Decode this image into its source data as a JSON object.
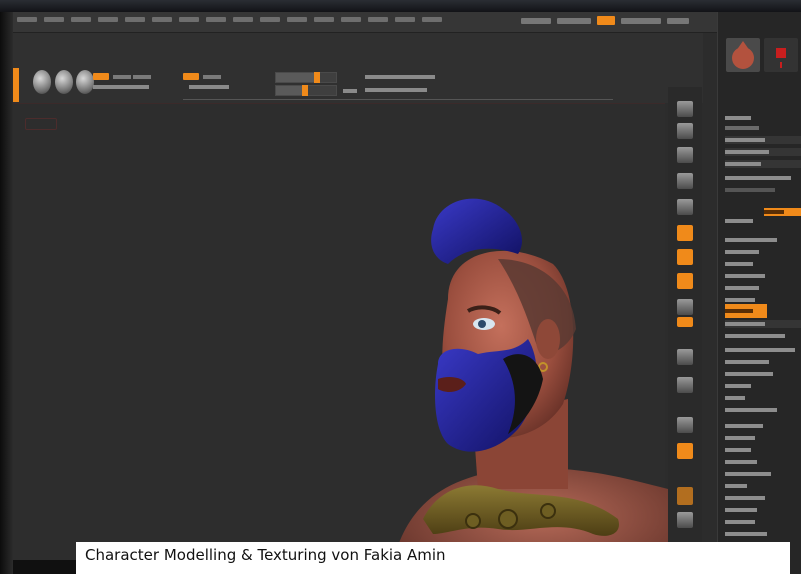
{
  "caption": {
    "text": "Character Modelling & Texturing von Fakia Amin"
  },
  "colors": {
    "accent": "#f08a1a",
    "panel": "#262626",
    "canvas": "#2d2d2d",
    "caption_background": "#ffffff"
  },
  "icons": {
    "brush_tools": [
      "brush-sphere-icon",
      "brush-sphere-icon",
      "brush-sphere-icon"
    ],
    "right_shelf": [
      "camera-icon",
      "perspective-icon",
      "floor-grid-icon",
      "local-icon",
      "xyz-axis-icon",
      "frame-icon",
      "move-icon",
      "scale-icon",
      "rotate-icon",
      "polyframe-icon",
      "transparency-icon",
      "solo-icon",
      "ghost-icon",
      "xpose-icon"
    ],
    "palette_thumbnails": [
      "material-icon",
      "texture-icon"
    ]
  }
}
